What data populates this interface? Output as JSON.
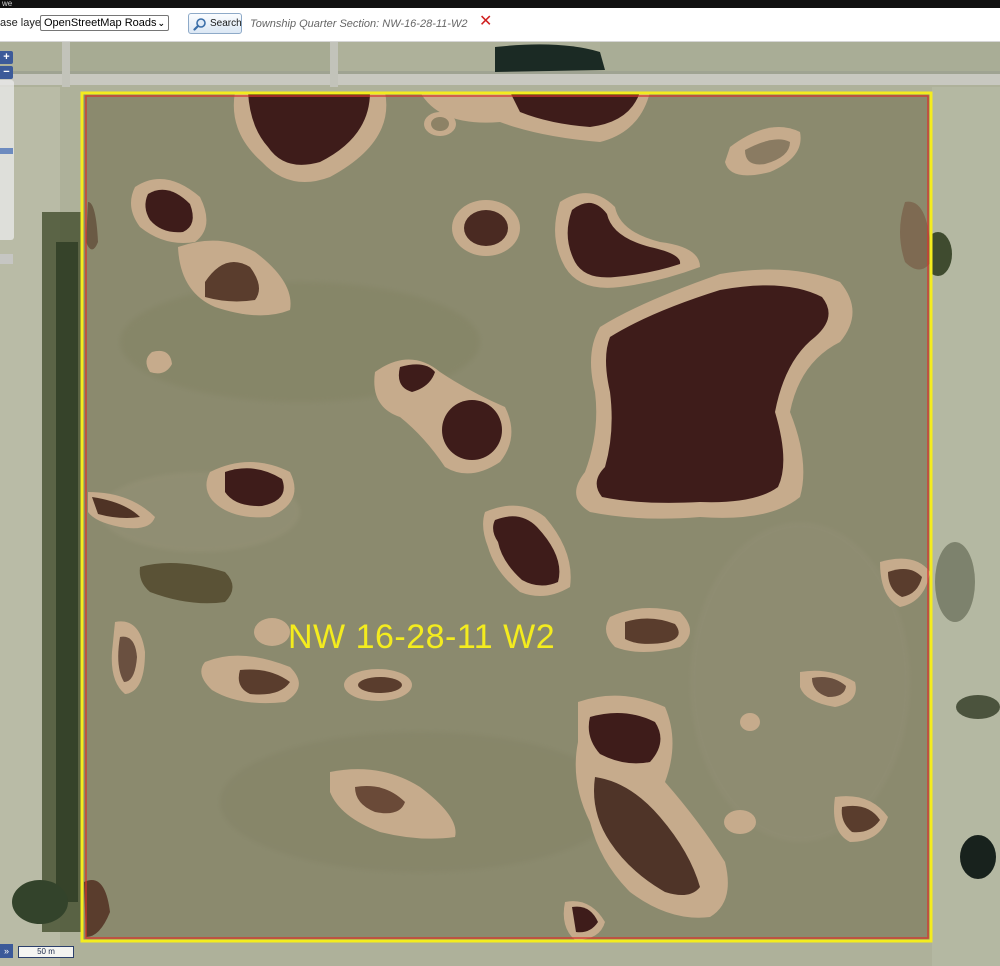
{
  "window": {
    "title_fragment": "we"
  },
  "toolbar": {
    "base_layer_label": "ase layer:",
    "base_layer_selected": "OpenStreetMap Roads",
    "search_label": "Search",
    "status_text": "Township Quarter Section: NW-16-28-11-W2",
    "clear_glyph": "✕"
  },
  "map": {
    "zoom_in_label": "+",
    "zoom_out_label": "−",
    "feature_label": "NW 16-28-11 W2",
    "scale_label": "50 m",
    "overview_glyph": "»",
    "colors": {
      "quarter_outline": "#f4ec1e",
      "parcel_outline": "#d8342a",
      "field": "#8b8a6e",
      "slough_water": "#3e1c1a",
      "slough_shore": "#c6ab8c",
      "road": "#c8c8c0",
      "ditch_water": "#1b2a24",
      "trees": "#3d4a2c"
    }
  }
}
